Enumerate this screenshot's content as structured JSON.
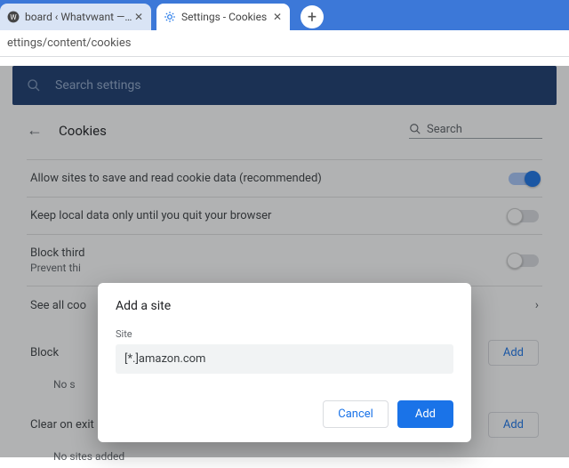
{
  "tabs": [
    {
      "title": "board ‹ Whatvwant — Wor",
      "favicon": "wordpress"
    },
    {
      "title": "Settings - Cookies",
      "favicon": "gear"
    }
  ],
  "address_bar": {
    "url_fragment": "ettings/content/cookies"
  },
  "search_banner": {
    "placeholder": "Search settings"
  },
  "header": {
    "title": "Cookies",
    "search_placeholder": "Search"
  },
  "rows": {
    "allow_label": "Allow sites to save and read cookie data (recommended)",
    "keep_label": "Keep local data only until you quit your browser",
    "block3p_label": "Block third",
    "block3p_sub": "Prevent thi",
    "seeall_label": "See all coo"
  },
  "sections": {
    "block": {
      "title": "Block",
      "add_label": "Add",
      "empty": "No s"
    },
    "clear": {
      "title": "Clear on exit",
      "add_label": "Add",
      "empty": "No sites added"
    }
  },
  "dialog": {
    "title": "Add a site",
    "field_label": "Site",
    "field_value": "[*.]amazon.com",
    "cancel": "Cancel",
    "add": "Add"
  }
}
